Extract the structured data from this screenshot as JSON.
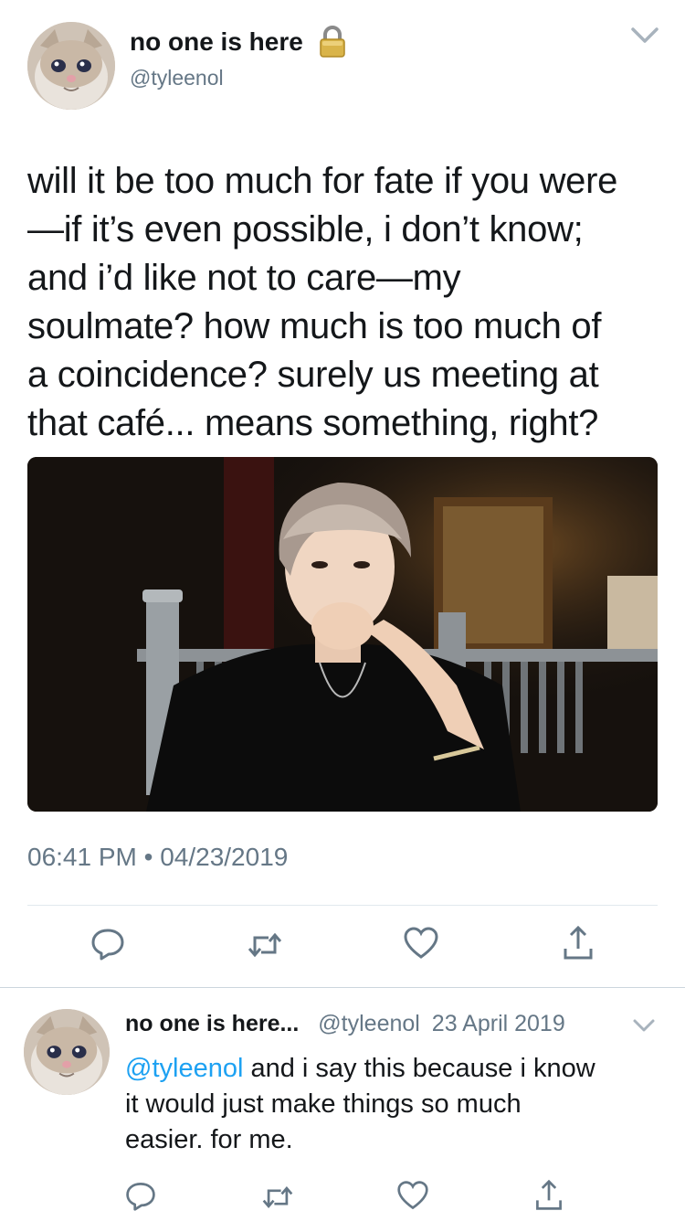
{
  "main_tweet": {
    "display_name": "no one is here",
    "handle": "@tyleenol",
    "lock_icon": "lock-icon",
    "body_lines": [
      "will it be too much for fate if you were",
      "—if it’s even possible, i don’t know;",
      "and i’d like not to care—my",
      "soulmate? how much is too much of",
      "a coincidence? surely us meeting at",
      "that café... means something, right?"
    ],
    "timestamp": "06:41 PM • 04/23/2019",
    "actions": [
      "reply-icon",
      "retweet-icon",
      "like-icon",
      "share-icon"
    ]
  },
  "reply_tweet": {
    "display_name": "no one is here...",
    "handle": "@tyleenol",
    "date": "23 April 2019",
    "mention": "@tyleenol",
    "body_lines": [
      " and i say this because i know",
      "it would just make things so much",
      "easier. for me."
    ],
    "actions": [
      "reply-icon",
      "retweet-icon",
      "like-icon",
      "share-icon"
    ]
  },
  "colors": {
    "text": "#14171a",
    "secondary": "#657786",
    "link": "#1da1f2",
    "divider": "#e1e8ed"
  }
}
